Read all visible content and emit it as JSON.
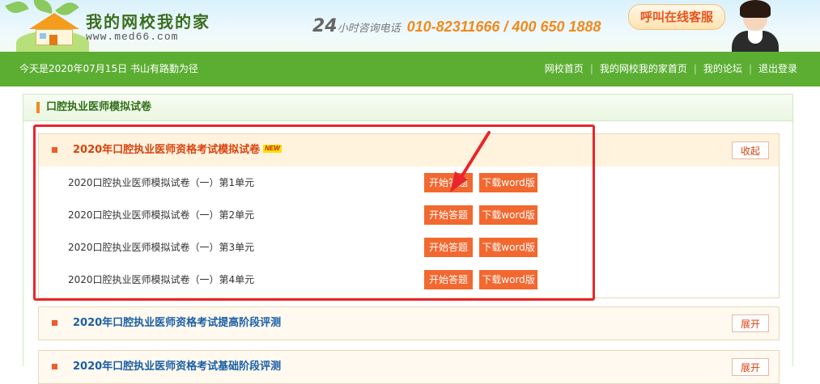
{
  "header": {
    "logo_text": "我的网校我的家",
    "logo_url": "www.med66.com",
    "hotline_24": "24",
    "hotline_label": "小时咨询电话",
    "hotline_numbers": "010-82311666 / 400 650 1888",
    "service_button": "呼叫在线客服"
  },
  "nav": {
    "date_text": "今天是2020年07月15日  书山有路勤为径",
    "links": [
      "网校首页",
      "我的网校我的家首页",
      "我的论坛",
      "退出登录"
    ]
  },
  "panel": {
    "title": "口腔执业医师模拟试卷"
  },
  "sections": [
    {
      "title": "2020年口腔执业医师资格考试模拟试卷",
      "badge": "NEW",
      "toggle": "收起",
      "rows": [
        {
          "label": "2020口腔执业医师模拟试卷（一）第1单元",
          "start": "开始答题",
          "word": "下载word版"
        },
        {
          "label": "2020口腔执业医师模拟试卷（一）第2单元",
          "start": "开始答题",
          "word": "下载word版"
        },
        {
          "label": "2020口腔执业医师模拟试卷（一）第3单元",
          "start": "开始答题",
          "word": "下载word版"
        },
        {
          "label": "2020口腔执业医师模拟试卷（一）第4单元",
          "start": "开始答题",
          "word": "下载word版"
        }
      ]
    },
    {
      "title": "2020年口腔执业医师资格考试提高阶段评测",
      "toggle": "展开"
    },
    {
      "title": "2020年口腔执业医师资格考试基础阶段评测",
      "toggle": "展开"
    }
  ],
  "colors": {
    "nav_green": "#5cae33",
    "accent_orange": "#f2682f",
    "highlight_red": "#e8262c",
    "open_title": "#d9430e",
    "closed_title": "#1a5fa6"
  }
}
